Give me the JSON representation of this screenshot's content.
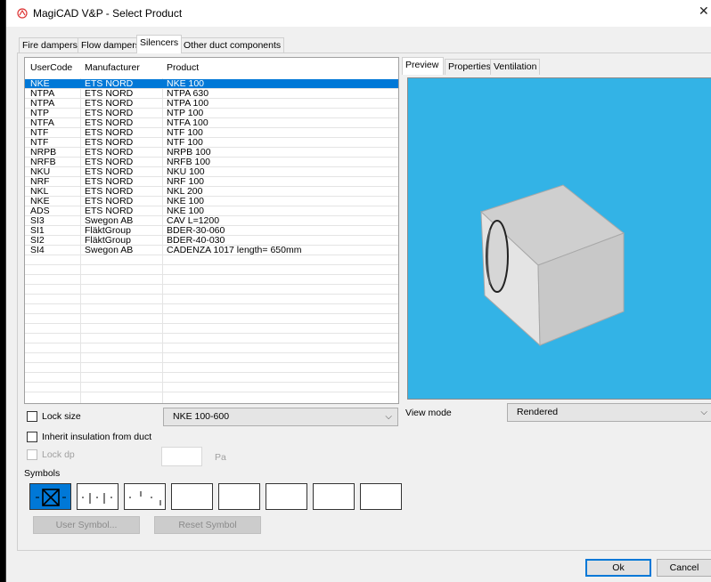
{
  "window": {
    "title": "MagiCAD V&P - Select Product",
    "close": "✕"
  },
  "tabs": [
    {
      "label": "Fire dampers"
    },
    {
      "label": "Flow dampers"
    },
    {
      "label": "Silencers"
    },
    {
      "label": "Other duct components"
    }
  ],
  "grid": {
    "headers": {
      "usercode": "UserCode",
      "manufacturer": "Manufacturer",
      "product": "Product"
    },
    "rows": [
      {
        "usercode": "NKE",
        "manufacturer": "ETS NORD",
        "product": "NKE 100"
      },
      {
        "usercode": "NTPA",
        "manufacturer": "ETS NORD",
        "product": "NTPA 630"
      },
      {
        "usercode": "NTPA",
        "manufacturer": "ETS NORD",
        "product": "NTPA 100"
      },
      {
        "usercode": "NTP",
        "manufacturer": "ETS NORD",
        "product": "NTP 100"
      },
      {
        "usercode": "NTFA",
        "manufacturer": "ETS NORD",
        "product": "NTFA 100"
      },
      {
        "usercode": "NTF",
        "manufacturer": "ETS NORD",
        "product": "NTF 100"
      },
      {
        "usercode": "NTF",
        "manufacturer": "ETS NORD",
        "product": "NTF 100"
      },
      {
        "usercode": "NRPB",
        "manufacturer": "ETS NORD",
        "product": "NRPB 100"
      },
      {
        "usercode": "NRFB",
        "manufacturer": "ETS NORD",
        "product": "NRFB 100"
      },
      {
        "usercode": "NKU",
        "manufacturer": "ETS NORD",
        "product": "NKU 100"
      },
      {
        "usercode": "NRF",
        "manufacturer": "ETS NORD",
        "product": "NRF 100"
      },
      {
        "usercode": "NKL",
        "manufacturer": "ETS NORD",
        "product": "NKL 200"
      },
      {
        "usercode": "NKE",
        "manufacturer": "ETS NORD",
        "product": "NKE 100"
      },
      {
        "usercode": "ADS",
        "manufacturer": "ETS NORD",
        "product": "NKE 100"
      },
      {
        "usercode": "SI3",
        "manufacturer": "Swegon AB",
        "product": "CAV L=1200"
      },
      {
        "usercode": "SI1",
        "manufacturer": "FläktGroup",
        "product": "BDER-30-060"
      },
      {
        "usercode": "SI2",
        "manufacturer": "FläktGroup",
        "product": "BDER-40-030"
      },
      {
        "usercode": "SI4",
        "manufacturer": "Swegon AB",
        "product": "CADENZA 1017 length= 650mm"
      }
    ]
  },
  "preview_tabs": [
    {
      "label": "Preview"
    },
    {
      "label": "Properties"
    },
    {
      "label": "Ventilation"
    }
  ],
  "options": {
    "lock_size": "Lock size",
    "size_value": "NKE 100-600",
    "inherit_insulation": "Inherit insulation from duct",
    "lock_dp": "Lock dp",
    "dp_unit": "Pa",
    "symbols": "Symbols",
    "user_symbol": "User Symbol...",
    "reset_symbol": "Reset Symbol"
  },
  "view_mode": {
    "label": "View mode",
    "value": "Rendered"
  },
  "footer": {
    "ok": "Ok",
    "cancel": "Cancel"
  },
  "colors": {
    "accent": "#0078d7",
    "preview_bg": "#33b3e6"
  }
}
